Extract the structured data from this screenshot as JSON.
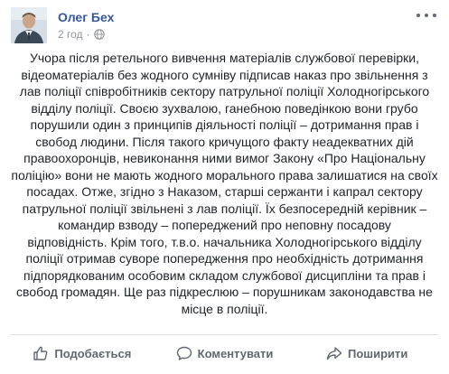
{
  "post": {
    "author": "Олег Бех",
    "time": "2 год",
    "separator": "·",
    "privacy_icon": "globe-icon",
    "more_icon": "ellipsis-icon",
    "text": "Учора після ретельного вивчення матеріалів службової перевірки,\nвідеоматеріалів без жодного сумніву підписав наказ про звільнення з\nлав поліції співробітників сектору патрульної поліції Холодногірського\nвідділу поліції. Своєю зухвалою, ганебною поведінкою вони грубо\nпорушили один з принципів діяльності поліції – дотримання прав і\nсвобод людини. Після такого кричущого факту неадекватних дій\nправоохоронців, невиконання ними вимог Закону «Про Національну\nполіцію» вони не мають жодного морального права залишатися на своїх\nпосадах. Отже, згідно з Наказом, старші сержанти і капрал сектору\nпатрульної поліції звільнені з лав поліції. Їх безпосередній керівник –\nкомандир взводу – попереджений про неповну посадову\nвідповідність. Крім того, т.в.о. начальника Холодногірського відділу\nполіції отримав суворе попередження про необхідність дотримання\nпідпорядкованим особовим складом службової дисципліни та прав і\nсвобод громадян. Ще раз підкреслюю – порушникам законодавства не\nмісце в поліції."
  },
  "actions": {
    "like_label": "Подобається",
    "like_icon": "thumbs-up-icon",
    "comment_label": "Коментувати",
    "comment_icon": "comment-icon",
    "share_label": "Поширити",
    "share_icon": "share-icon"
  },
  "colors": {
    "author_link": "#365899",
    "meta_gray": "#90949c",
    "action_gray": "#606770",
    "text": "#1d2129"
  }
}
